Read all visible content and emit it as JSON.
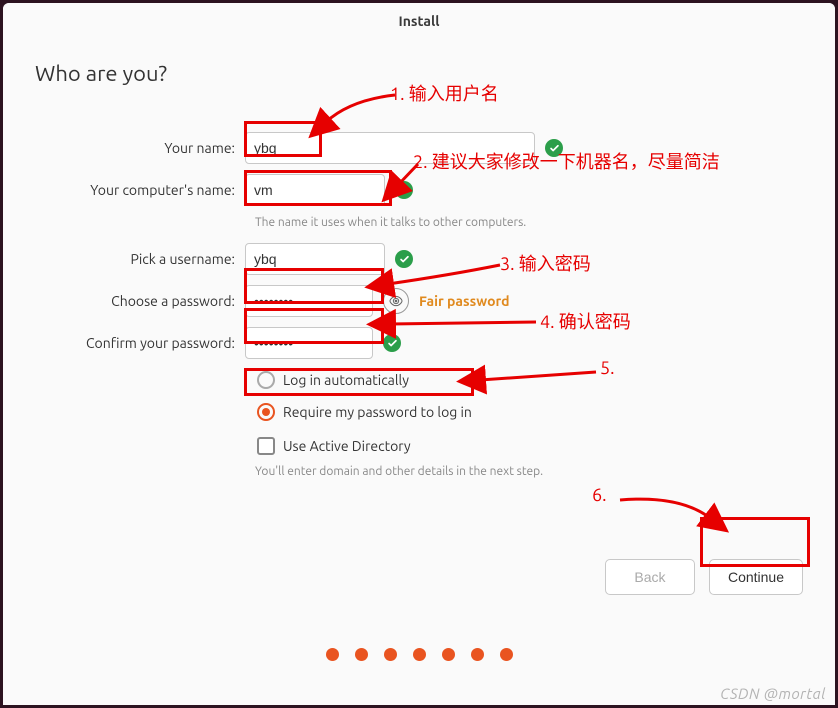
{
  "window": {
    "title": "Install"
  },
  "heading": "Who are you?",
  "form": {
    "name": {
      "label": "Your name:",
      "value": "ybq"
    },
    "computer": {
      "label": "Your computer's name:",
      "value": "vm",
      "hint": "The name it uses when it talks to other computers."
    },
    "username": {
      "label": "Pick a username:",
      "value": "ybq"
    },
    "password": {
      "label": "Choose a password:",
      "value": "••••••••",
      "strength": "Fair password"
    },
    "confirm": {
      "label": "Confirm your password:",
      "value": "••••••••"
    },
    "radio": {
      "auto": "Log in automatically",
      "require": "Require my password to log in",
      "selected": "require"
    },
    "ad": {
      "label": "Use Active Directory",
      "hint": "You'll enter domain and other details in the next step."
    }
  },
  "buttons": {
    "back": "Back",
    "continue": "Continue"
  },
  "dots": 7,
  "annotations": {
    "a1": "1. 输入用户名",
    "a2": "2. 建议大家修改一下机器名，尽量简洁",
    "a3": "3. 输入密码",
    "a4": "4. 确认密码",
    "a5": "5.",
    "a6": "6."
  },
  "watermark": "CSDN @mortal"
}
